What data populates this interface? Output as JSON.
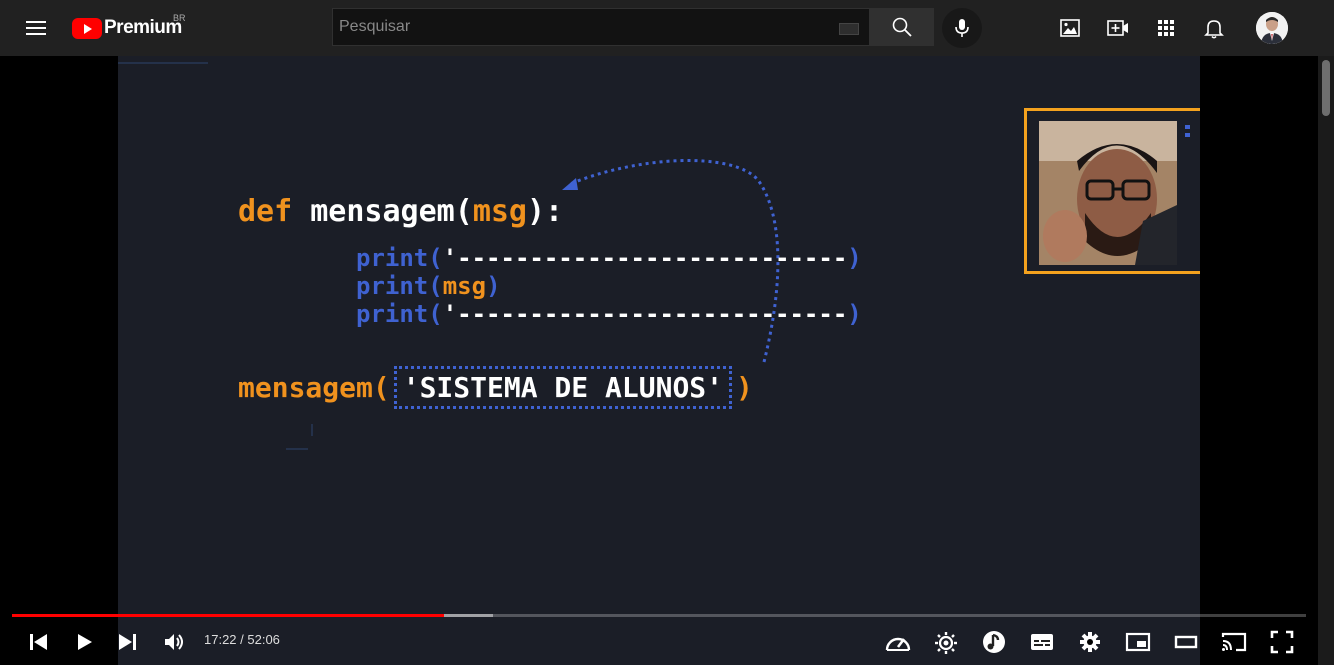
{
  "header": {
    "brand": "Premium",
    "region": "BR",
    "search_placeholder": "Pesquisar"
  },
  "icons": {
    "menu": "menu-icon",
    "search": "search-icon",
    "mic": "mic-icon",
    "image": "image-icon",
    "create": "video-camera-plus-icon",
    "apps": "apps-grid-icon",
    "notifications": "bell-icon"
  },
  "video": {
    "code": {
      "kw_def": "def",
      "func_name": "mensagem(",
      "param": "msg",
      "def_close": "):",
      "print1_kw": "print(",
      "print1_str": "'---------------------------",
      "print1_close": ")",
      "print2_kw": "print(",
      "print2_arg": "msg",
      "print2_close": ")",
      "print3_kw": "print(",
      "print3_str": "'---------------------------",
      "print3_close": ")",
      "call_name": "mensagem(",
      "call_arg": "'SISTEMA DE ALUNOS'",
      "call_close": ")"
    }
  },
  "player": {
    "current_time": "17:22",
    "duration": "52:06",
    "time_display": "17:22 / 52:06",
    "progress_fraction": 0.334,
    "buffered_fraction": 0.372
  },
  "colors": {
    "accent": "#ff0000",
    "code_orange": "#f0921e",
    "code_blue": "#3f62d1",
    "cam_border": "#f4a21e"
  }
}
